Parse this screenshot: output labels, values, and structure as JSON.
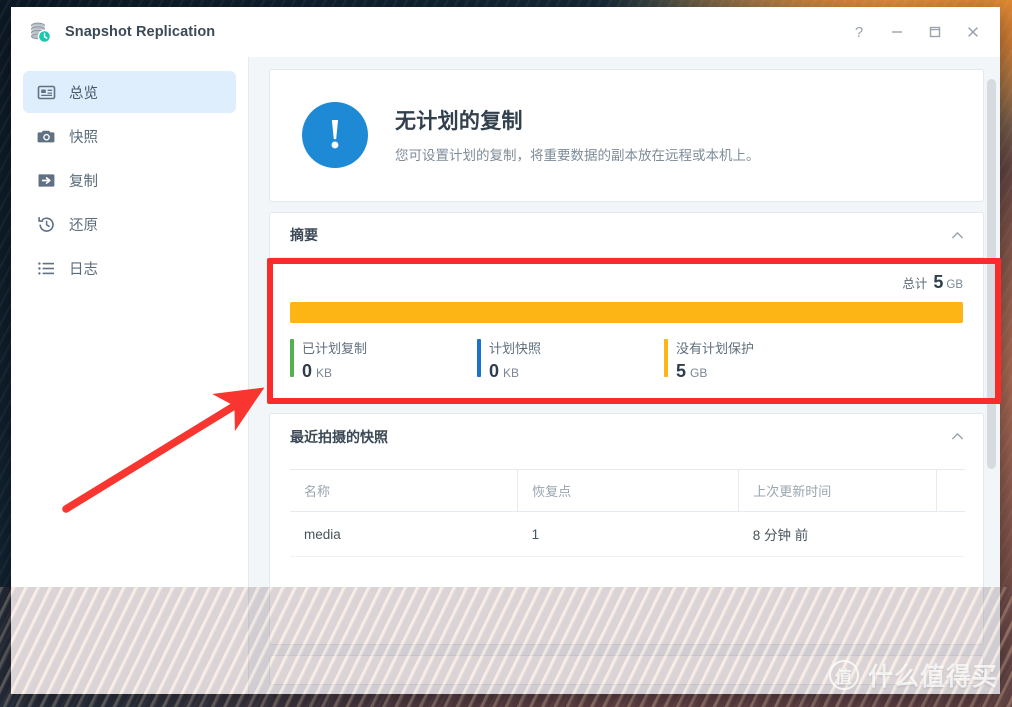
{
  "window": {
    "title": "Snapshot Replication",
    "icon": "database-clock-icon",
    "controls": {
      "help": "?",
      "minimize": "minimize-icon",
      "maximize": "maximize-icon",
      "close": "close-icon"
    }
  },
  "sidebar": {
    "items": [
      {
        "label": "总览",
        "icon": "overview-card-icon",
        "active": true
      },
      {
        "label": "快照",
        "icon": "camera-icon",
        "active": false
      },
      {
        "label": "复制",
        "icon": "replicate-arrow-icon",
        "active": false
      },
      {
        "label": "还原",
        "icon": "restore-clock-icon",
        "active": false
      },
      {
        "label": "日志",
        "icon": "list-icon",
        "active": false
      }
    ]
  },
  "alert": {
    "icon": "exclamation-icon",
    "glyph": "!",
    "title": "无计划的复制",
    "subtitle": "您可设置计划的复制，将重要数据的副本放在远程或本机上。",
    "color": "#1e8ad6"
  },
  "summary": {
    "title": "摘要",
    "collapse_icon": "chevron-up-icon",
    "total_label": "总计",
    "total_value": "5",
    "total_unit": "GB",
    "bar": [
      {
        "name": "已计划复制",
        "percent": 0,
        "color": "#52b14c"
      },
      {
        "name": "计划快照",
        "percent": 0,
        "color": "#1a73c8"
      },
      {
        "name": "没有计划保护",
        "percent": 100,
        "color": "#fdb515"
      }
    ],
    "legend": [
      {
        "name": "已计划复制",
        "value": "0",
        "unit": "KB",
        "color": "#52b14c"
      },
      {
        "name": "计划快照",
        "value": "0",
        "unit": "KB",
        "color": "#1a73c8"
      },
      {
        "name": "没有计划保护",
        "value": "5",
        "unit": "GB",
        "color": "#fdb515"
      }
    ]
  },
  "recent_snapshots": {
    "title": "最近拍摄的快照",
    "collapse_icon": "chevron-up-icon",
    "columns": [
      "名称",
      "恢复点",
      "上次更新时间"
    ],
    "rows": [
      {
        "name": "media",
        "restore_points": "1",
        "last_update": "8 分钟 前"
      }
    ]
  },
  "annotations": {
    "highlight_color": "#fb2b29",
    "arrow_color": "#f8352f"
  },
  "watermark": {
    "badge": "值",
    "text": "什么值得买"
  }
}
